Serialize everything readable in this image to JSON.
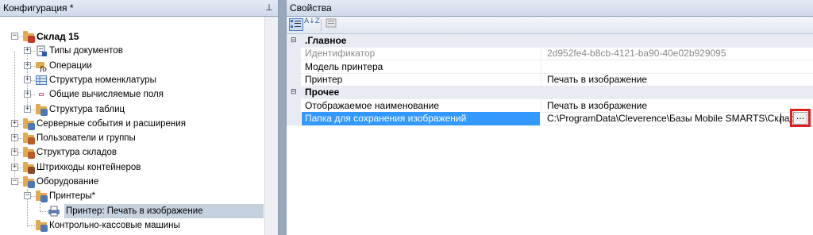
{
  "left_panel": {
    "title": "Конфигурация *",
    "pin_icon": "pin-icon",
    "tree": [
      {
        "label": "Склад 15",
        "level": 0,
        "bold": true,
        "expander": "−",
        "icon": "folder-cart-icon"
      },
      {
        "label": "Типы документов",
        "level": 1,
        "expander": "+",
        "icon": "document-types-icon"
      },
      {
        "label": "Операции",
        "level": 1,
        "expander": "+",
        "icon": "operations-fx-icon"
      },
      {
        "label": "Структура номенклатуры",
        "level": 1,
        "expander": "+",
        "icon": "table-grid-icon"
      },
      {
        "label": "Общие вычисляемые поля",
        "level": 1,
        "expander": "+",
        "icon": "computed-fields-icon"
      },
      {
        "label": "Структура таблиц",
        "level": 1,
        "expander": "+",
        "icon": "folder-table-icon"
      },
      {
        "label": "Серверные события и расширения",
        "level": 0,
        "expander": "+",
        "icon": "folder-gear-icon"
      },
      {
        "label": "Пользователи и группы",
        "level": 0,
        "expander": "+",
        "icon": "folder-users-icon"
      },
      {
        "label": "Структура складов",
        "level": 0,
        "expander": "+",
        "icon": "folder-warehouse-icon"
      },
      {
        "label": "Штрихкоды контейнеров",
        "level": 0,
        "expander": "+",
        "icon": "folder-barcode-icon"
      },
      {
        "label": "Оборудование",
        "level": 0,
        "expander": "−",
        "icon": "folder-equipment-icon"
      },
      {
        "label": "Принтеры*",
        "level": 1,
        "expander": "−",
        "icon": "folder-printer-icon"
      },
      {
        "label": "Принтер: Печать в изображение",
        "level": 2,
        "expander": "",
        "icon": "printer-icon",
        "selected": true
      },
      {
        "label": "Контрольно-кассовые машины",
        "level": 1,
        "expander": "",
        "icon": "folder-cash-register-icon"
      }
    ]
  },
  "right_panel": {
    "title": "Свойства",
    "toolbar": {
      "categorized_icon": "categorized-view-icon",
      "alphabetical_icon": "sort-alphabetical-icon",
      "alphabetical_label": "A↓Z",
      "pages_icon": "property-pages-icon"
    },
    "categories": [
      {
        "name": ".Главное",
        "rows": [
          {
            "name": "Идентификатор",
            "value": "2d952fe4-b8cb-4121-ba90-40e02b929095",
            "readonly": true
          },
          {
            "name": "Модель принтера",
            "value": ""
          },
          {
            "name": "Принтер",
            "value": "Печать в изображение"
          }
        ]
      },
      {
        "name": "Прочее",
        "rows": [
          {
            "name": "Отображаемое наименование",
            "value": "Печать в изображение"
          },
          {
            "name": "Папка для сохранения изображений",
            "value": "C:\\ProgramData\\Cleverence\\Базы Mobile SMARTS\\Склад",
            "selected": true,
            "button_label": "..."
          }
        ]
      }
    ]
  },
  "colors": {
    "selection_blue": "#3399ff",
    "highlight_red": "#e01e1e",
    "folder_orange": "#e3a94e",
    "tree_selection": "#c6d1e0"
  }
}
